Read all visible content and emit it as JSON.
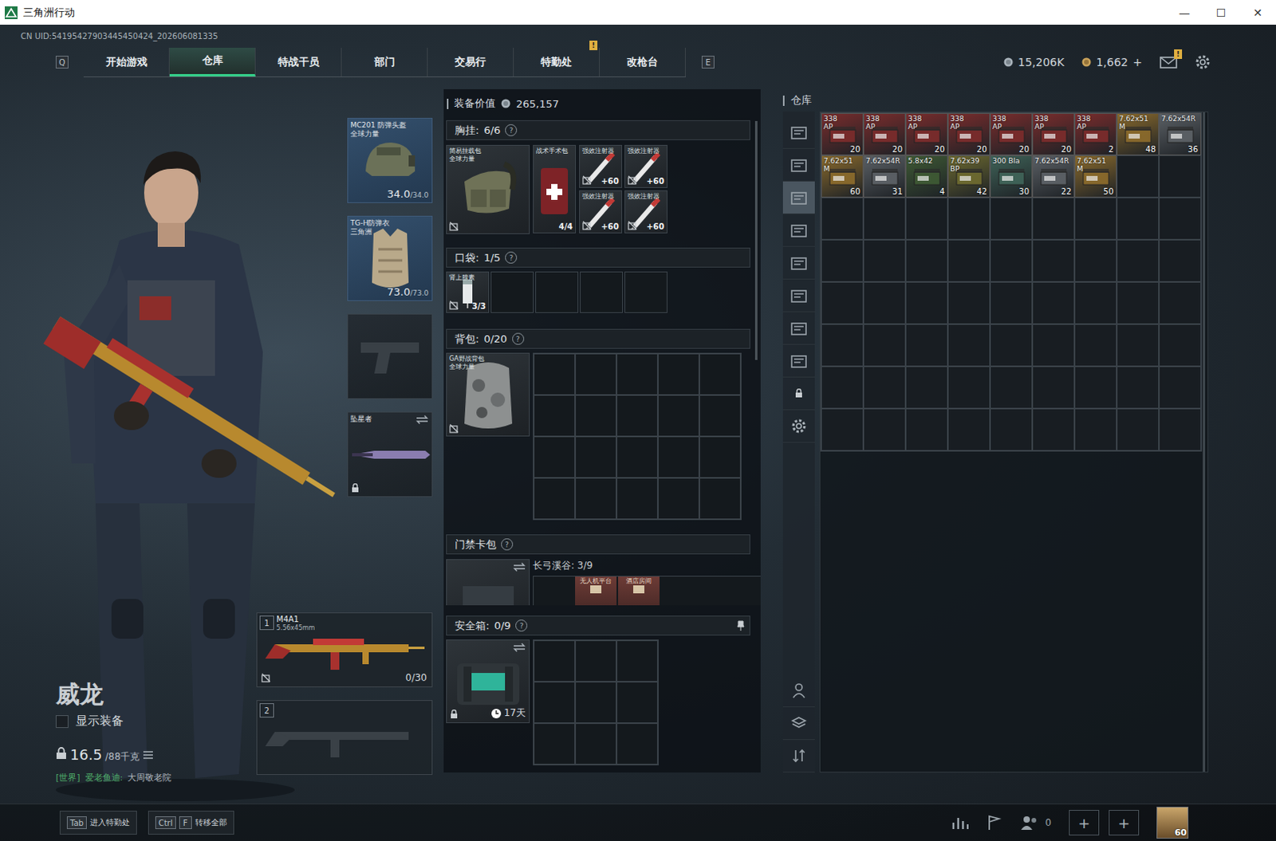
{
  "window": {
    "title": "三角洲行动",
    "controls": [
      "—",
      "☐",
      "✕"
    ]
  },
  "uid": "CN UID:54195427903445450424_202606081335",
  "nav": {
    "prev_key": "Q",
    "next_key": "E",
    "tabs": [
      {
        "label": "开始游戏",
        "selected": false
      },
      {
        "label": "仓库",
        "selected": true
      },
      {
        "label": "特战干员",
        "selected": false
      },
      {
        "label": "部门",
        "selected": false
      },
      {
        "label": "交易行",
        "selected": false
      },
      {
        "label": "特勤处",
        "selected": false,
        "badge": "!"
      },
      {
        "label": "改枪台",
        "selected": false
      }
    ]
  },
  "currency": [
    {
      "value": "15,206K",
      "kind": "silver"
    },
    {
      "value": "1,662",
      "kind": "gold",
      "action": "+"
    }
  ],
  "mail": {
    "badge": "!"
  },
  "character": {
    "name": "威龙",
    "show_equipment": {
      "label": "显示装备",
      "checked": false
    },
    "weight": "16.5",
    "weight_max": "/88千克",
    "chat": {
      "channel": "[世界]",
      "user": "爱老鱼迪:",
      "text": "大周敬老院"
    }
  },
  "gear_slots": [
    {
      "kind": "helmet",
      "name": "MC201 防弹头盔",
      "sub": "全球力量",
      "durability": "34.0",
      "max": "/34.0"
    },
    {
      "kind": "armor",
      "name": "TG-H防弹衣",
      "sub": "三角洲",
      "durability": "73.0",
      "max": "/73.0"
    },
    {
      "kind": "pistol"
    },
    {
      "kind": "melee",
      "name": "坠星者"
    }
  ],
  "weapons": [
    {
      "index": "1",
      "name": "M4A1",
      "caliber": "5.56x45mm",
      "ammo": "0/30"
    },
    {
      "index": "2"
    }
  ],
  "loadout": {
    "value_label": "装备价值",
    "value": "265,157",
    "chest": {
      "title": "胸挂:",
      "count": "6/6",
      "help": "?",
      "rig": {
        "name": "简易挂载包",
        "sub": "全球力量"
      },
      "items": [
        {
          "kind": "kit",
          "name": "战术手术包",
          "count": "4/4"
        },
        {
          "kind": "injector",
          "name": "强效注射器",
          "count": "+60"
        },
        {
          "kind": "injector",
          "name": "强效注射器",
          "count": "+60"
        },
        {
          "kind": "injector",
          "name": "强效注射器",
          "count": "+60"
        },
        {
          "kind": "injector",
          "name": "强效注射器",
          "count": "+60"
        }
      ]
    },
    "pockets": {
      "title": "口袋:",
      "count": "1/5",
      "help": "?",
      "items": [
        {
          "name": "肾上腺素",
          "count": "3/3"
        }
      ]
    },
    "backpack": {
      "title": "背包:",
      "count": "0/20",
      "help": "?",
      "name": "GA野战背包",
      "sub": "全球力量"
    },
    "keycards": {
      "title": "门禁卡包",
      "help": "?",
      "map": "长弓溪谷: 3/9",
      "cards": [
        "无人机平台",
        "酒店房间"
      ]
    },
    "safe": {
      "title": "安全箱:",
      "count": "0/9",
      "help": "?",
      "timer": "17天"
    }
  },
  "warehouse": {
    "title": "仓库",
    "side_tabs": [
      {
        "selected": false
      },
      {
        "selected": false
      },
      {
        "selected": true
      },
      {
        "selected": false
      },
      {
        "selected": false
      },
      {
        "selected": false
      },
      {
        "selected": false
      },
      {
        "selected": false
      }
    ],
    "items": [
      {
        "line1": "338",
        "line2": "AP",
        "count": "20",
        "color": "#7a2c2c"
      },
      {
        "line1": "338",
        "line2": "AP",
        "count": "20",
        "color": "#7a2c2c"
      },
      {
        "line1": "338",
        "line2": "AP",
        "count": "20",
        "color": "#7a2c2c"
      },
      {
        "line1": "338",
        "line2": "AP",
        "count": "20",
        "color": "#7a2c2c"
      },
      {
        "line1": "338",
        "line2": "AP",
        "count": "20",
        "color": "#7a2c2c"
      },
      {
        "line1": "338",
        "line2": "AP",
        "count": "20",
        "color": "#7a2c2c"
      },
      {
        "line1": "338",
        "line2": "AP",
        "count": "2",
        "color": "#7a2c2c"
      },
      {
        "line1": "7.62x51",
        "line2": "M",
        "count": "48",
        "color": "#8a6a2c"
      },
      {
        "line1": "7.62x54R",
        "line2": "",
        "count": "36",
        "color": "#5b6065"
      },
      {
        "line1": "7.62x51",
        "line2": "M",
        "count": "60",
        "color": "#8a6a2c"
      },
      {
        "line1": "7.62x54R",
        "line2": "",
        "count": "31",
        "color": "#5b6065"
      },
      {
        "line1": "5.8x42",
        "line2": "",
        "count": "4",
        "color": "#3e5934"
      },
      {
        "line1": "7.62x39",
        "line2": "BP",
        "count": "42",
        "color": "#6d6a30"
      },
      {
        "line1": "300 Bla",
        "line2": "",
        "count": "30",
        "color": "#3f6358"
      },
      {
        "line1": "7.62x54R",
        "line2": "",
        "count": "22",
        "color": "#5b6065"
      },
      {
        "line1": "7.62x51",
        "line2": "M",
        "count": "50",
        "color": "#8a6a2c"
      }
    ]
  },
  "bottom_bar": {
    "hints": [
      {
        "keys": [
          "Tab"
        ],
        "label": "进入特勤处"
      },
      {
        "keys": [
          "Ctrl",
          "F"
        ],
        "label": "转移全部"
      }
    ],
    "party_count": "0",
    "add_slots": [
      "+",
      "+"
    ],
    "level": "60"
  }
}
